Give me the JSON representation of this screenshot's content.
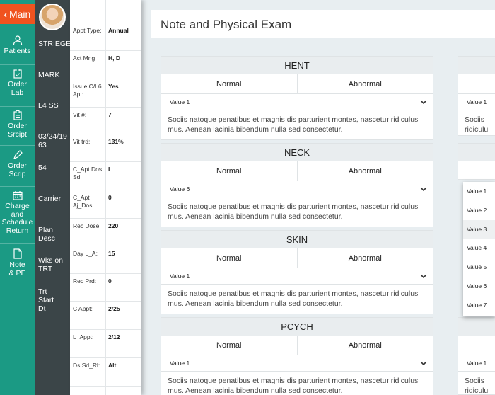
{
  "nav": {
    "main_label": "Main",
    "items": [
      {
        "label": "Patients",
        "icon": "person-icon"
      },
      {
        "label": "Order Lab",
        "icon": "clipboard-icon"
      },
      {
        "label": "Order Srcipt",
        "icon": "clipboard-icon"
      },
      {
        "label": "Order Scrip",
        "icon": "pen-icon"
      },
      {
        "label": "Charge and Schedule Return",
        "icon": "calendar-icon"
      },
      {
        "label": "Note & PE",
        "icon": "document-icon"
      }
    ]
  },
  "patient": {
    "name": "STRIEGEL",
    "first": "MARK",
    "ssn": "L4 SS",
    "dob": "03/24/1963",
    "age": "54",
    "carrier": "Carrier",
    "plan": "Plan Desc",
    "wks": "Wks on TRT",
    "trt_start": "Trt Start Dt"
  },
  "appt": [
    {
      "k": "Appt Type:",
      "v": "Annual"
    },
    {
      "k": "Act Mng",
      "v": "H, D"
    },
    {
      "k": "Issue C/L6 Apt:",
      "v": "Yes"
    },
    {
      "k": "Vit #:",
      "v": "7"
    },
    {
      "k": "Vit trd:",
      "v": "131%"
    },
    {
      "k": "C_Apt Dos Sd:",
      "v": "L"
    },
    {
      "k": "C_Apt Aj_Dos:",
      "v": "0"
    },
    {
      "k": "Rec Dose:",
      "v": "220"
    },
    {
      "k": "Day L_A:",
      "v": "15"
    },
    {
      "k": "Rec Prd:",
      "v": "0"
    },
    {
      "k": "C Appt:",
      "v": "2/25"
    },
    {
      "k": "L_Appt:",
      "v": "2/12"
    },
    {
      "k": "Ds Sd_Rl:",
      "v": "Alt"
    },
    {
      "k": "",
      "v": ""
    }
  ],
  "header": {
    "title": "Note and Physical Exam"
  },
  "sections": [
    {
      "title": "HENT",
      "normal": "Normal",
      "abnormal": "Abnormal",
      "value": "Value 1",
      "text": "Sociis natoque penatibus et magnis dis parturient montes, nascetur ridiculus mus. Aenean lacinia bibendum nulla sed consectetur."
    },
    {
      "title": "NECK",
      "normal": "Normal",
      "abnormal": "Abnormal",
      "value": "Value 6",
      "text": "Sociis natoque penatibus et magnis dis parturient montes, nascetur ridiculus mus. Aenean lacinia bibendum nulla sed consectetur."
    },
    {
      "title": "SKIN",
      "normal": "Normal",
      "abnormal": "Abnormal",
      "value": "Value 1",
      "text": "Sociis natoque penatibus et magnis dis parturient montes, nascetur ridiculus mus. Aenean lacinia bibendum nulla sed consectetur."
    },
    {
      "title": "PCYCH",
      "normal": "Normal",
      "abnormal": "Abnormal",
      "value": "Value 1",
      "text": "Sociis natoque penatibus et magnis dis parturient montes, nascetur ridiculus mus. Aenean lacinia bibendum nulla sed consectetur."
    }
  ],
  "right_cards": [
    {
      "value": "Value 1",
      "text1": "Sociis",
      "text2": "ridiculu"
    },
    {
      "value": "Value 1",
      "text1": "Sociis",
      "text2": "ridiculu"
    }
  ],
  "dropdown_options": [
    "Value 1",
    "Value 2",
    "Value 3",
    "Value 4",
    "Value 5",
    "Value 6",
    "Value 7"
  ],
  "colors": {
    "nav": "#1b9a84",
    "main_button": "#f0531f",
    "patient_col": "#3b4548"
  }
}
